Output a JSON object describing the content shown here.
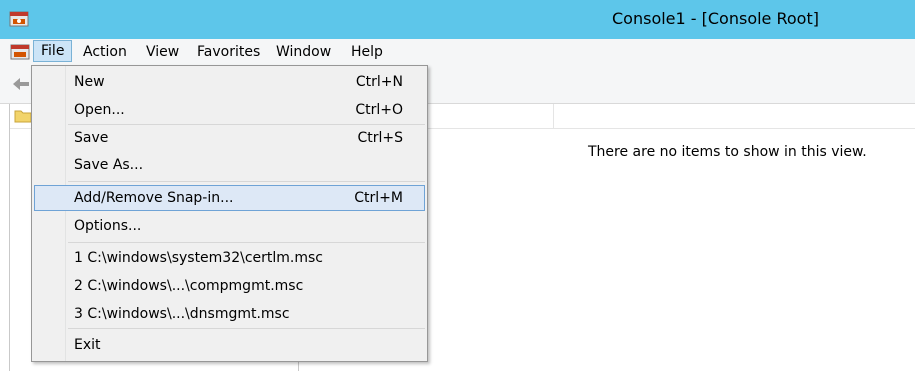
{
  "window": {
    "title": "Console1 - [Console Root]"
  },
  "menubar": {
    "items": [
      {
        "label": "File"
      },
      {
        "label": "Action"
      },
      {
        "label": "View"
      },
      {
        "label": "Favorites"
      },
      {
        "label": "Window"
      },
      {
        "label": "Help"
      }
    ]
  },
  "file_menu": {
    "items": [
      {
        "label": "New",
        "shortcut": "Ctrl+N"
      },
      {
        "label": "Open...",
        "shortcut": "Ctrl+O"
      },
      {
        "label": "Save",
        "shortcut": "Ctrl+S"
      },
      {
        "label": "Save As...",
        "shortcut": ""
      },
      {
        "label": "Add/Remove Snap-in...",
        "shortcut": "Ctrl+M"
      },
      {
        "label": "Options...",
        "shortcut": ""
      },
      {
        "label": "1 C:\\windows\\system32\\certlm.msc",
        "shortcut": ""
      },
      {
        "label": "2 C:\\windows\\...\\compmgmt.msc",
        "shortcut": ""
      },
      {
        "label": "3 C:\\windows\\...\\dnsmgmt.msc",
        "shortcut": ""
      },
      {
        "label": "Exit",
        "shortcut": ""
      }
    ]
  },
  "content": {
    "empty_message": "There are no items to show in this view."
  },
  "icons": {
    "app": "mmc-console-icon",
    "back": "back-arrow-icon",
    "folder": "folder-icon"
  },
  "colors": {
    "titlebar": "#5dc6ea",
    "menu_highlight": "#cce4f7",
    "item_highlight": "#dde8f6"
  }
}
